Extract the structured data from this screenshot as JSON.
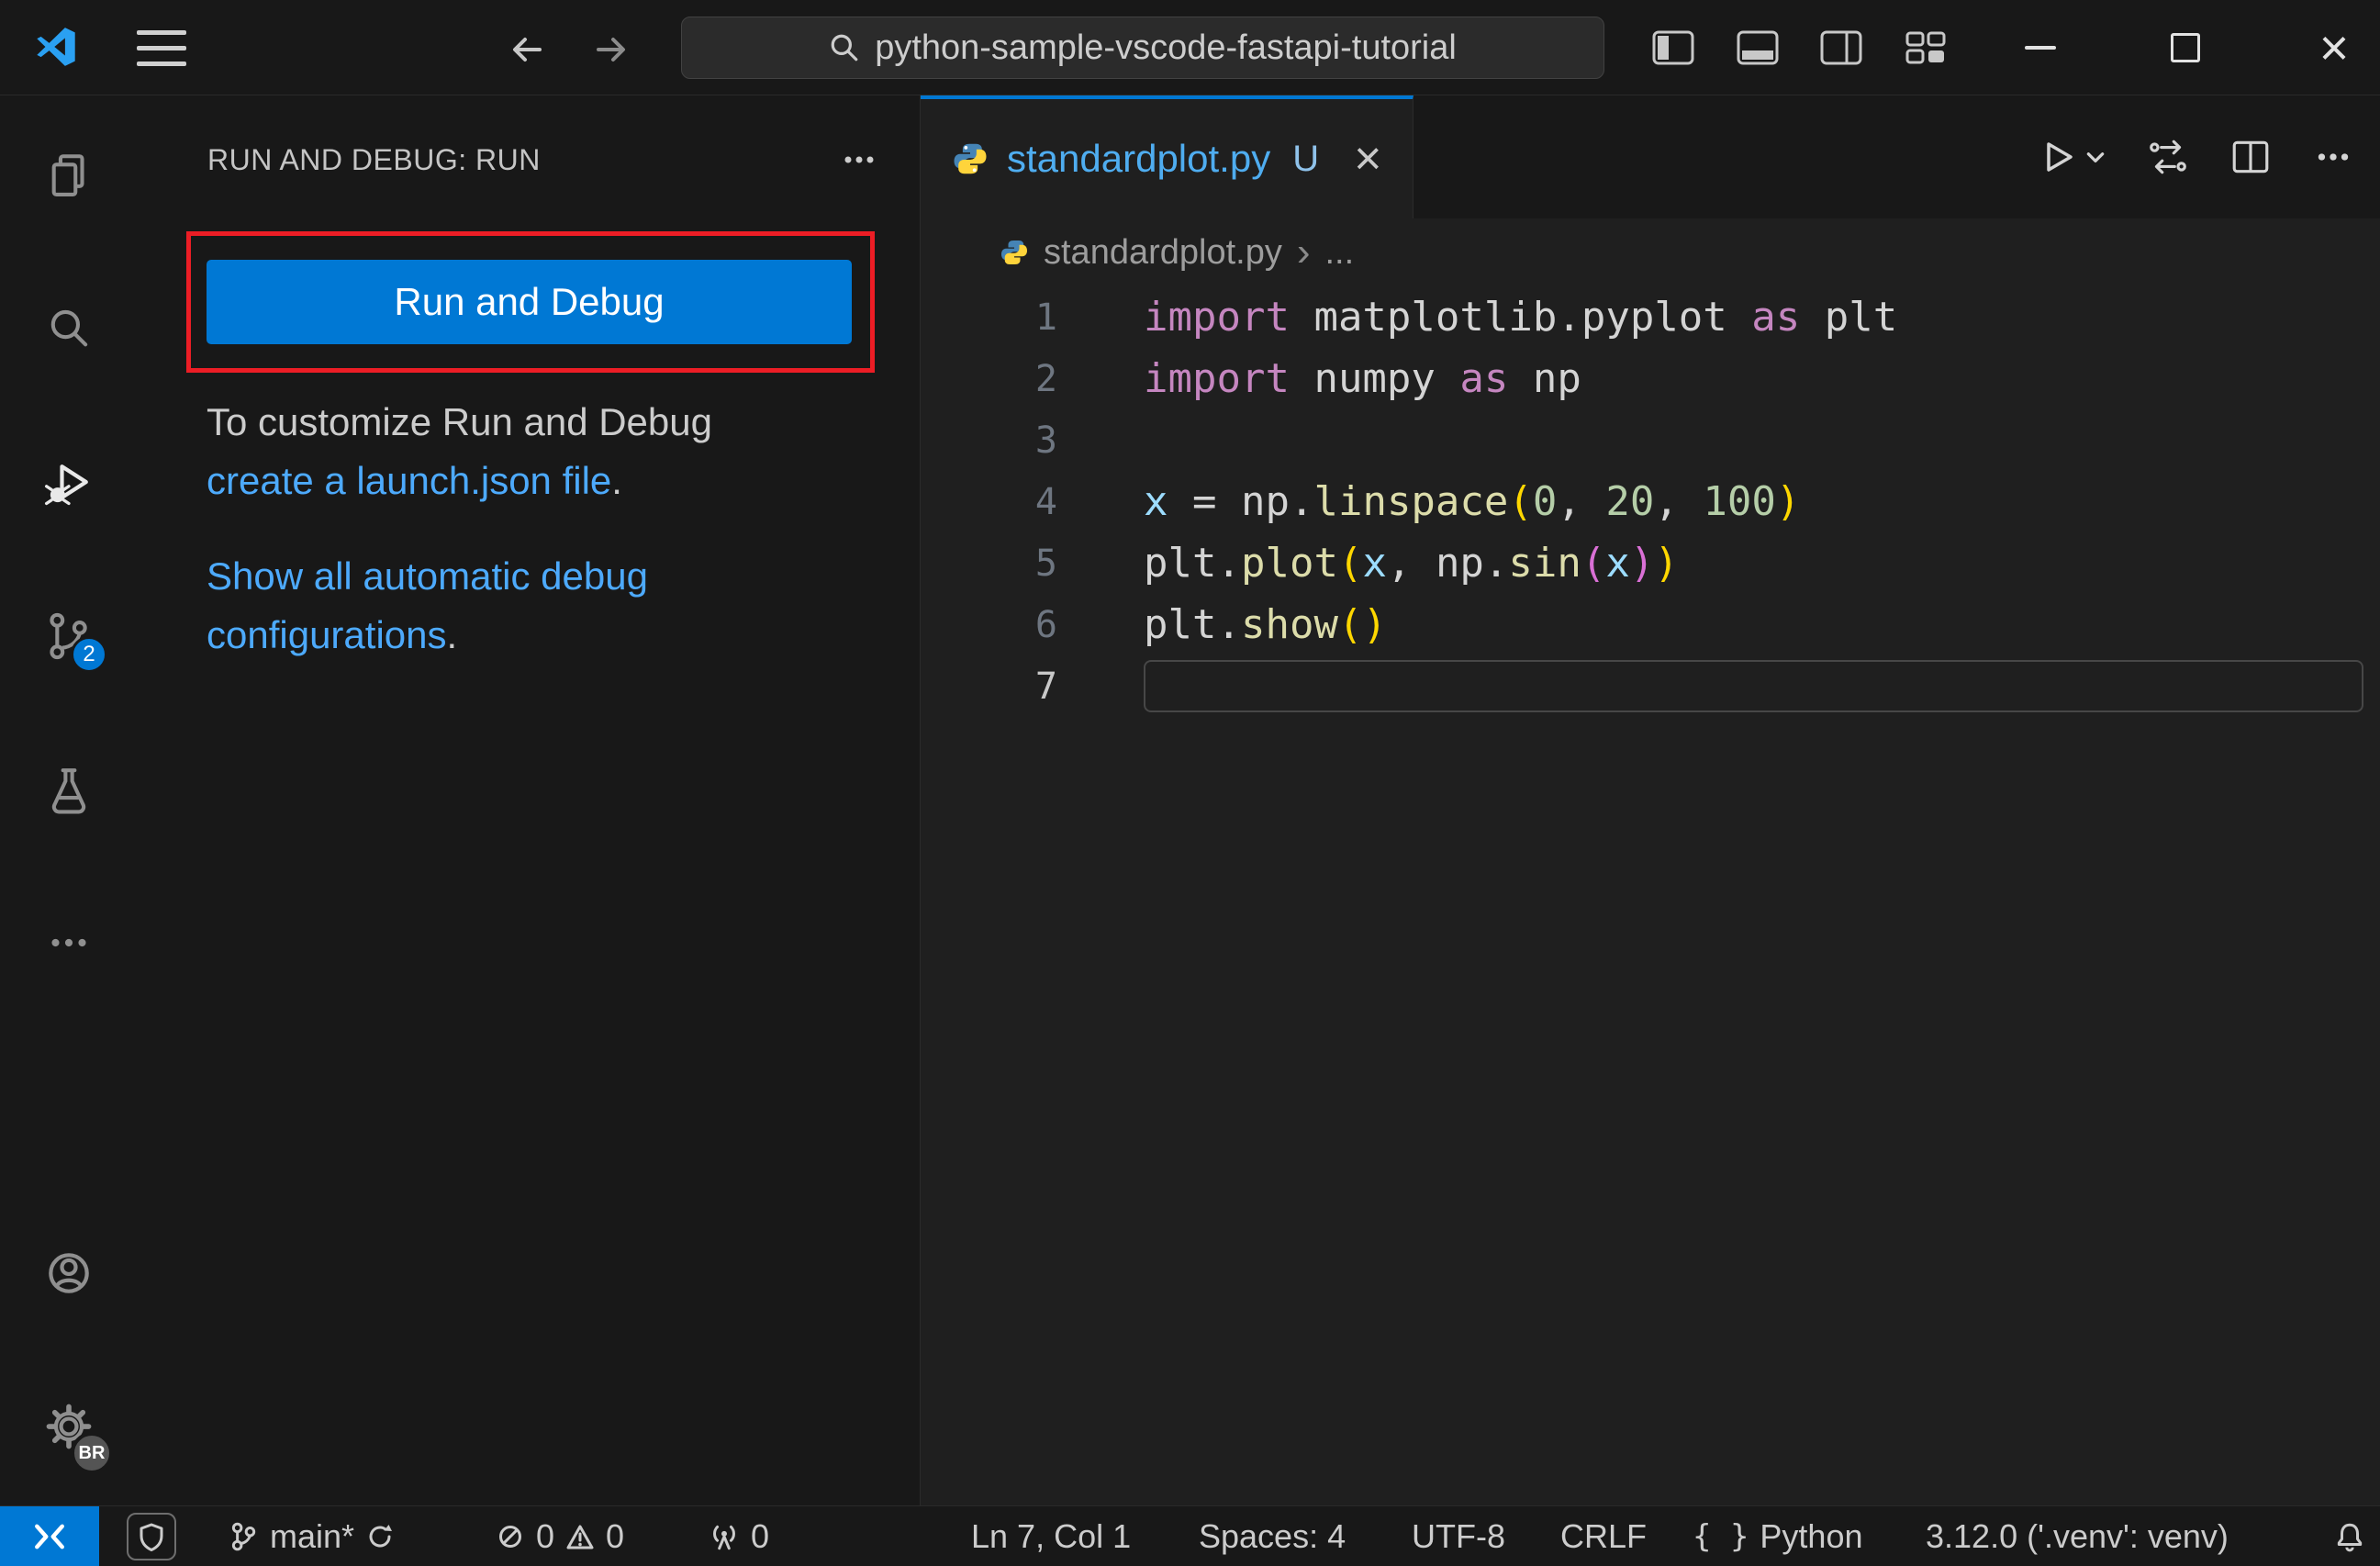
{
  "title_bar": {
    "search_text": "python-sample-vscode-fastapi-tutorial"
  },
  "activity_bar": {
    "scm_badge": "2",
    "profile_badge": "BR"
  },
  "sidebar": {
    "header_title": "RUN AND DEBUG: RUN",
    "run_button_label": "Run and Debug",
    "customize_prefix": "To customize Run and Debug ",
    "launch_link_label": "create a launch.json file",
    "launch_link_suffix": ".",
    "configs_link_label": "Show all automatic debug configurations",
    "configs_link_suffix": "."
  },
  "editor": {
    "tab": {
      "filename": "standardplot.py",
      "git_status": "U"
    },
    "breadcrumb": {
      "filename": "standardplot.py",
      "symbol_placeholder": "..."
    },
    "code_lines": [
      {
        "num": "1",
        "tokens": [
          [
            "kw",
            "import"
          ],
          [
            "pl",
            " "
          ],
          [
            "mod",
            "matplotlib.pyplot"
          ],
          [
            "pl",
            " "
          ],
          [
            "kw",
            "as"
          ],
          [
            "pl",
            " "
          ],
          [
            "mod",
            "plt"
          ]
        ]
      },
      {
        "num": "2",
        "tokens": [
          [
            "kw",
            "import"
          ],
          [
            "pl",
            " "
          ],
          [
            "mod",
            "numpy"
          ],
          [
            "pl",
            " "
          ],
          [
            "kw",
            "as"
          ],
          [
            "pl",
            " "
          ],
          [
            "mod",
            "np"
          ]
        ]
      },
      {
        "num": "3",
        "tokens": []
      },
      {
        "num": "4",
        "tokens": [
          [
            "var",
            "x"
          ],
          [
            "pl",
            " = "
          ],
          [
            "mod",
            "np"
          ],
          [
            "pl",
            "."
          ],
          [
            "fn",
            "linspace"
          ],
          [
            "p1",
            "("
          ],
          [
            "num",
            "0"
          ],
          [
            "pl",
            ", "
          ],
          [
            "num",
            "20"
          ],
          [
            "pl",
            ", "
          ],
          [
            "num",
            "100"
          ],
          [
            "p1",
            ")"
          ]
        ]
      },
      {
        "num": "5",
        "tokens": [
          [
            "mod",
            "plt"
          ],
          [
            "pl",
            "."
          ],
          [
            "fn",
            "plot"
          ],
          [
            "p1",
            "("
          ],
          [
            "var",
            "x"
          ],
          [
            "pl",
            ", "
          ],
          [
            "mod",
            "np"
          ],
          [
            "pl",
            "."
          ],
          [
            "fn",
            "sin"
          ],
          [
            "p2",
            "("
          ],
          [
            "var",
            "x"
          ],
          [
            "p2",
            ")"
          ],
          [
            "p1",
            ")"
          ]
        ]
      },
      {
        "num": "6",
        "tokens": [
          [
            "mod",
            "plt"
          ],
          [
            "pl",
            "."
          ],
          [
            "fn",
            "show"
          ],
          [
            "p1",
            "("
          ],
          [
            "p1",
            ")"
          ]
        ]
      },
      {
        "num": "7",
        "tokens": [],
        "current": true
      }
    ]
  },
  "status_bar": {
    "branch_label": "main*",
    "error_count": "0",
    "warning_count": "0",
    "port_count": "0",
    "cursor_position": "Ln 7, Col 1",
    "indentation": "Spaces: 4",
    "encoding": "UTF-8",
    "eol": "CRLF",
    "language_braces": "{ }",
    "language": "Python",
    "interpreter": "3.12.0 ('.venv': venv)"
  },
  "icons": {
    "breadcrumb_separator": "›",
    "tab_close": "×",
    "window_close": "×"
  },
  "colors": {
    "accent_blue": "#0078d4",
    "link_blue": "#4daafc",
    "annotation_red": "#ec1d25",
    "tab_file_blue": "#4fadf0"
  }
}
